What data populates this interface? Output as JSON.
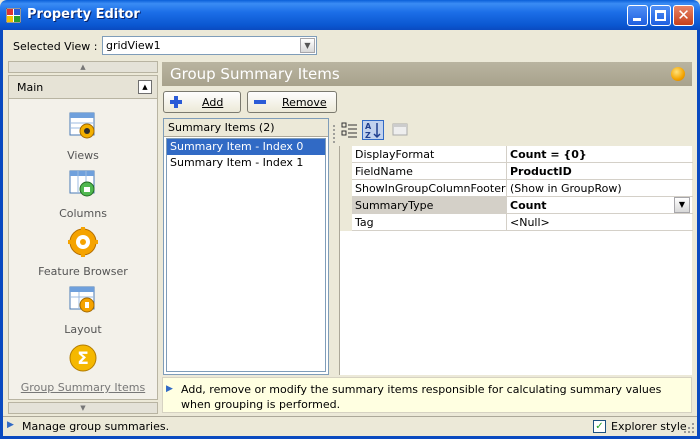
{
  "window": {
    "title": "Property Editor",
    "icons": {
      "app": "app-grid-icon",
      "minimize": "minimize-icon",
      "maximize": "maximize-icon",
      "close": "close-icon"
    },
    "close_glyph": "✕"
  },
  "selected_view": {
    "label": "Selected View :",
    "value": "gridView1",
    "dropdown_icon": "chevron-down-icon"
  },
  "nav": {
    "scroll_up_icon": "scroll-up-icon",
    "scroll_down_icon": "scroll-down-icon",
    "group_label": "Main",
    "collapse_icon": "collapse-icon",
    "items": [
      {
        "label": "Views",
        "icon": "views-icon"
      },
      {
        "label": "Columns",
        "icon": "columns-icon"
      },
      {
        "label": "Feature Browser",
        "icon": "feature-browser-icon"
      },
      {
        "label": "Layout",
        "icon": "layout-icon"
      },
      {
        "label": "Group Summary Items",
        "icon": "group-summary-icon",
        "selected": true
      }
    ]
  },
  "panel": {
    "title": "Group Summary Items",
    "pin_icon": "pin-icon",
    "add_label": "Add",
    "remove_label": "Remove",
    "list_header": "Summary Items (2)",
    "summary_items": [
      {
        "label": "Summary Item - Index 0",
        "selected": true
      },
      {
        "label": "Summary Item - Index 1",
        "selected": false
      }
    ],
    "toolbar_icons": [
      "categorized-icon",
      "alphabetical-sort-icon",
      "property-pages-icon"
    ],
    "properties": [
      {
        "name": "DisplayFormat",
        "value": "Count = {0}",
        "bold": true,
        "selected": false
      },
      {
        "name": "FieldName",
        "value": "ProductID",
        "bold": true,
        "selected": false
      },
      {
        "name": "ShowInGroupColumnFooter",
        "value": "(Show in GroupRow)",
        "bold": false,
        "selected": false
      },
      {
        "name": "SummaryType",
        "value": "Count",
        "bold": true,
        "selected": true
      },
      {
        "name": "Tag",
        "value": "<Null>",
        "bold": false,
        "selected": false
      }
    ],
    "hint": "Add, remove or modify the summary items responsible for calculating summary values when grouping is performed."
  },
  "status": {
    "text": "Manage group summaries.",
    "explorer_style_label": "Explorer style",
    "explorer_style_checked": true
  },
  "colors": {
    "title_bar": "#0a56d0",
    "selection": "#316ac5",
    "panel_header": "#aaa48e",
    "hint_bg": "#ffffe1"
  }
}
